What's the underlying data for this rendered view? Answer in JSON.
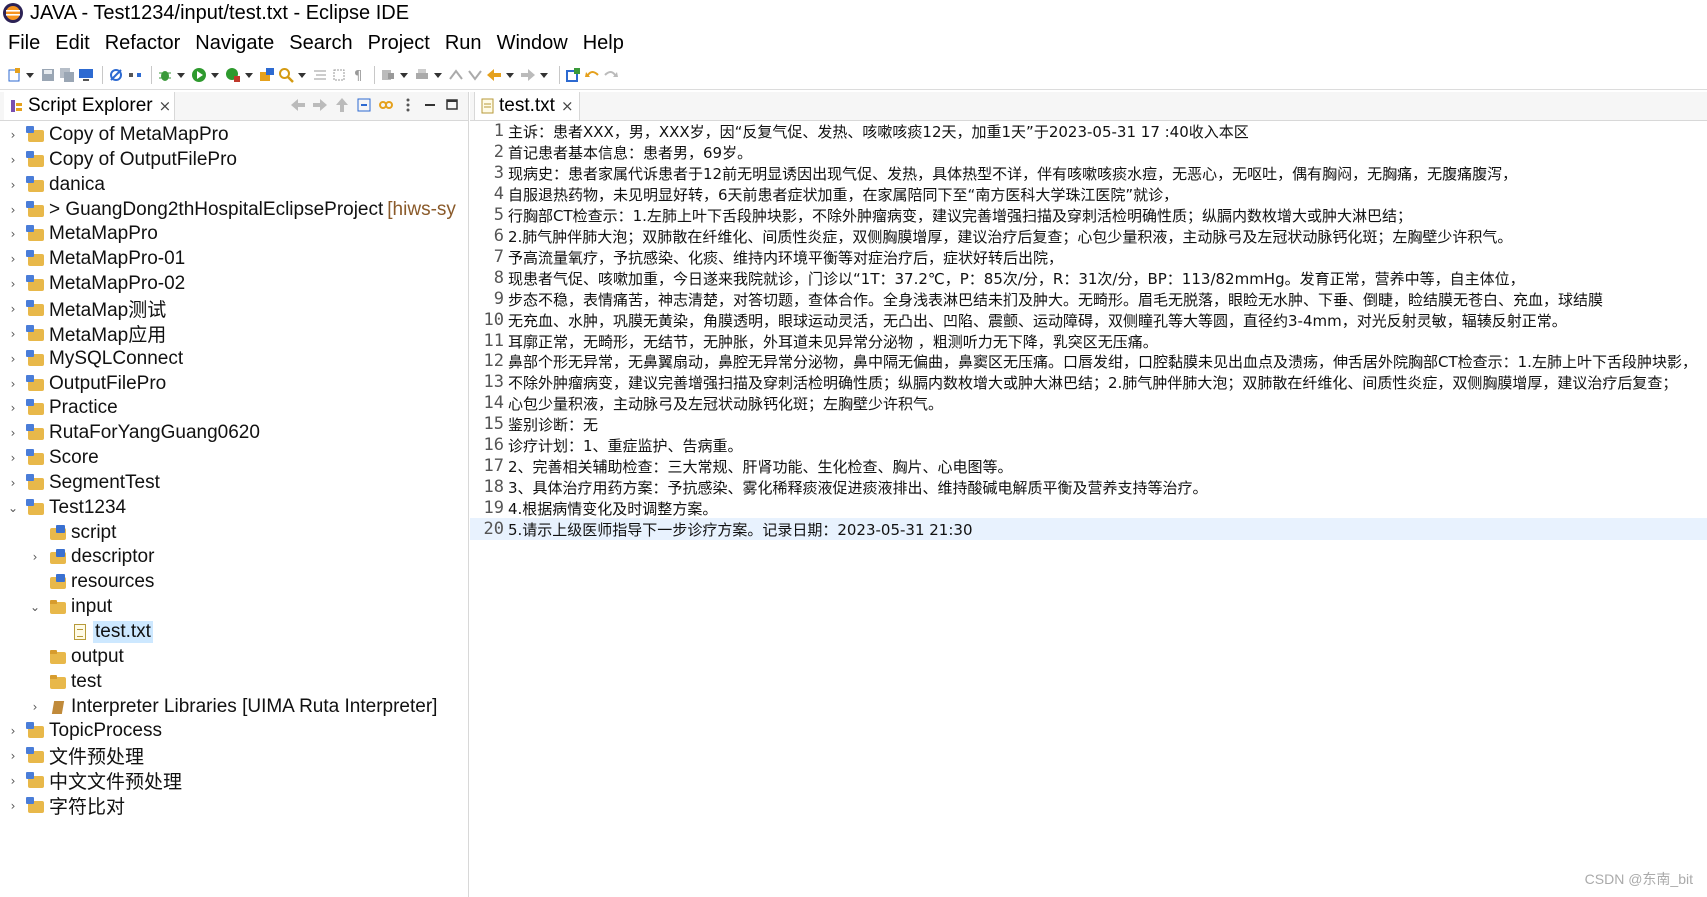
{
  "window": {
    "title": "JAVA - Test1234/input/test.txt - Eclipse IDE"
  },
  "menu": [
    "File",
    "Edit",
    "Refactor",
    "Navigate",
    "Search",
    "Project",
    "Run",
    "Window",
    "Help"
  ],
  "left_view": {
    "tab_label": "Script Explorer",
    "tab_close": "×"
  },
  "tree": [
    {
      "label": "Copy of MetaMapPro",
      "icon": "project-icon",
      "depth": 0,
      "arrow": "›"
    },
    {
      "label": "Copy of OutputFilePro",
      "icon": "project-icon",
      "depth": 0,
      "arrow": "›"
    },
    {
      "label": "danica",
      "icon": "project-icon",
      "depth": 0,
      "arrow": "›"
    },
    {
      "label": "> GuangDong2thHospitalEclipseProject",
      "suffix": "[hiws-sy",
      "icon": "project-icon",
      "depth": 0,
      "arrow": "›"
    },
    {
      "label": "MetaMapPro",
      "icon": "project-icon",
      "depth": 0,
      "arrow": "›"
    },
    {
      "label": "MetaMapPro-01",
      "icon": "project-icon",
      "depth": 0,
      "arrow": "›"
    },
    {
      "label": "MetaMapPro-02",
      "icon": "project-icon",
      "depth": 0,
      "arrow": "›"
    },
    {
      "label": "MetaMap测试",
      "icon": "project-icon",
      "depth": 0,
      "arrow": "›"
    },
    {
      "label": "MetaMap应用",
      "icon": "project-icon",
      "depth": 0,
      "arrow": "›"
    },
    {
      "label": "MySQLConnect",
      "icon": "project-icon",
      "depth": 0,
      "arrow": "›"
    },
    {
      "label": "OutputFilePro",
      "icon": "project-icon",
      "depth": 0,
      "arrow": "›"
    },
    {
      "label": "Practice",
      "icon": "project-icon",
      "depth": 0,
      "arrow": "›"
    },
    {
      "label": "RutaForYangGuang0620",
      "icon": "project-icon",
      "depth": 0,
      "arrow": "›"
    },
    {
      "label": "Score",
      "icon": "project-icon",
      "depth": 0,
      "arrow": "›"
    },
    {
      "label": "SegmentTest",
      "icon": "project-icon",
      "depth": 0,
      "arrow": "›"
    },
    {
      "label": "Test1234",
      "icon": "project-icon",
      "depth": 0,
      "arrow": "⌄"
    },
    {
      "label": "script",
      "icon": "package-icon",
      "depth": 1,
      "arrow": ""
    },
    {
      "label": "descriptor",
      "icon": "package-icon",
      "depth": 1,
      "arrow": "›"
    },
    {
      "label": "resources",
      "icon": "package-icon",
      "depth": 1,
      "arrow": ""
    },
    {
      "label": "input",
      "icon": "folder-icon",
      "depth": 1,
      "arrow": "⌄"
    },
    {
      "label": "test.txt",
      "icon": "text-file-icon",
      "depth": 2,
      "arrow": "",
      "selected": true
    },
    {
      "label": "output",
      "icon": "folder-icon",
      "depth": 1,
      "arrow": ""
    },
    {
      "label": "test",
      "icon": "folder-icon",
      "depth": 1,
      "arrow": ""
    },
    {
      "label": "Interpreter Libraries [UIMA Ruta Interpreter]",
      "icon": "library-icon",
      "depth": 1,
      "arrow": "›"
    },
    {
      "label": "TopicProcess",
      "icon": "project-icon",
      "depth": 0,
      "arrow": "›"
    },
    {
      "label": "文件预处理",
      "icon": "project-icon",
      "depth": 0,
      "arrow": "›"
    },
    {
      "label": "中文文件预处理",
      "icon": "project-icon",
      "depth": 0,
      "arrow": "›"
    },
    {
      "label": "字符比对",
      "icon": "project-icon",
      "depth": 0,
      "arrow": "›"
    }
  ],
  "editor": {
    "tab_label": "test.txt",
    "tab_close": "×",
    "current_line": 20,
    "lines": [
      "主诉：患者XXX，男，XXX岁，因“反复气促、发热、咳嗽咳痰12天，加重1天”于2023-05-31 17 :40收入本区",
      "首记患者基本信息：患者男，69岁。",
      "现病史：患者家属代诉患者于12前无明显诱因出现气促、发热，具体热型不详，伴有咳嗽咳痰水痘，无恶心，无呕吐，偶有胸闷，无胸痛，无腹痛腹泻，",
      "自服退热药物，未见明显好转，6天前患者症状加重，在家属陪同下至“南方医科大学珠江医院”就诊，",
      "行胸部CT检查示：1.左肺上叶下舌段肿块影，不除外肿瘤病变，建议完善增强扫描及穿刺活检明确性质；纵膈内数枚增大或肿大淋巴结；",
      "2.肺气肿伴肺大泡；双肺散在纤维化、间质性炎症，双侧胸膜增厚，建议治疗后复查；心包少量积液，主动脉弓及左冠状动脉钙化斑；左胸壁少许积气。",
      "予高流量氧疗，予抗感染、化痰、维持内环境平衡等对症治疗后，症状好转后出院，",
      "现患者气促、咳嗽加重，今日遂来我院就诊，门诊以“1T：37.2℃，P：85次/分，R：31次/分，BP：113/82mmHg。发育正常，营养中等，自主体位，",
      "步态不稳，表情痛苦，神志清楚，对答切题，查体合作。全身浅表淋巴结未扪及肿大。无畸形。眉毛无脱落，眼睑无水肿、下垂、倒睫，睑结膜无苍白、充血，球结膜",
      "无充血、水肿，巩膜无黄染，角膜透明，眼球运动灵活，无凸出、凹陷、震颤、运动障碍，双侧瞳孔等大等圆，直径约3-4mm，对光反射灵敏，辐辏反射正常。",
      "耳廓正常，无畸形，无结节，无肿胀，外耳道未见异常分泌物 ，粗测听力无下降，乳突区无压痛。",
      "鼻部个形无异常，无鼻翼扇动，鼻腔无异常分泌物，鼻中隔无偏曲，鼻窦区无压痛。口唇发绀，口腔黏膜未见出血点及溃疡，伸舌居外院胸部CT检查示：1.左肺上叶下舌段肿块影，",
      "不除外肿瘤病变，建议完善增强扫描及穿刺活检明确性质；纵膈内数枚增大或肿大淋巴结；2.肺气肿伴肺大泡；双肺散在纤维化、间质性炎症，双侧胸膜增厚，建议治疗后复查；",
      "心包少量积液，主动脉弓及左冠状动脉钙化斑；左胸壁少许积气。",
      "鉴别诊断：无",
      "诊疗计划：1、重症监护、告病重。",
      "      2、完善相关辅助检查：三大常规、肝肾功能、生化检查、胸片、心电图等。",
      "      3、具体治疗用药方案：予抗感染、雾化稀释痰液促进痰液排出、维持酸碱电解质平衡及营养支持等治疗。",
      "      4.根据病情变化及时调整方案。",
      "      5.请示上级医师指导下一步诊疗方案。记录日期：2023-05-31 21:30"
    ]
  },
  "watermark": "CSDN @东南_bit"
}
